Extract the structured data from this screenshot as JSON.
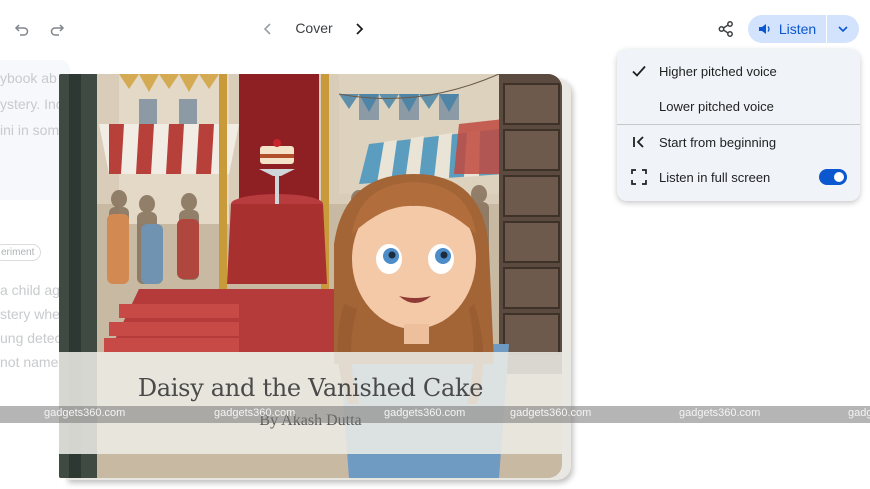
{
  "toolbar": {
    "page_label": "Cover",
    "listen_label": "Listen",
    "icons": [
      "undo-icon",
      "redo-icon",
      "chevron-left-icon",
      "chevron-right-icon",
      "share-icon",
      "speaker-icon",
      "chevron-down-icon"
    ]
  },
  "left_column": {
    "lines": [
      "ybook ab",
      "ystery. Inc",
      "ini in som",
      "a child ag",
      "stery when",
      "ung detec",
      "not named"
    ],
    "chip": "eriment"
  },
  "book": {
    "title": "Daisy and the Vanished Cake",
    "author": "By Akash Dutta"
  },
  "menu": {
    "items": [
      {
        "label": "Higher pitched voice",
        "icon": "check-icon",
        "selected": true
      },
      {
        "label": "Lower pitched voice",
        "icon": "",
        "selected": false
      },
      {
        "label": "Start from beginning",
        "icon": "skip-to-start-icon"
      },
      {
        "label": "Listen in full screen",
        "icon": "fullscreen-icon",
        "toggle_on": true
      }
    ]
  },
  "watermark": {
    "texts": [
      "gadgets360.com",
      "gadgets360.com",
      "gadgets360.com",
      "gadgets360.com",
      "gadgets360.com",
      "gadg"
    ]
  },
  "colors": {
    "accent": "#0b57d0",
    "listen_bg": "#d3e3fd",
    "menu_bg": "#f0f4f9"
  }
}
